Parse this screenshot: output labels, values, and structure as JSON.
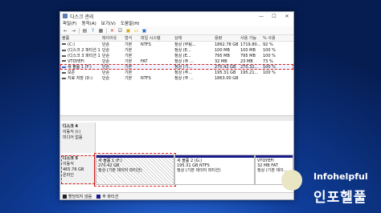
{
  "window": {
    "title": "디스크 관리"
  },
  "window_buttons": {
    "minimize": "—",
    "maximize": "☐",
    "close": "✕"
  },
  "menu": [
    "파일(F)",
    "동작(A)",
    "보기(V)",
    "도움말(H)"
  ],
  "toolbar": {
    "back": "←",
    "forward": "→",
    "properties": "▤",
    "help": "?",
    "grid": "▦",
    "delete": "✕",
    "check": "☑",
    "save": "▣",
    "folder": "▭",
    "magnify": "▣"
  },
  "columns": {
    "volume": "볼륨",
    "layout": "레이아웃",
    "type": "형식",
    "fs": "파일 시스템",
    "status": "상태",
    "capacity": "용량",
    "free": "사용 가능",
    "pct": "% 사용"
  },
  "volumes": [
    {
      "volume": "(C:)",
      "layout": "단순",
      "type": "기본",
      "fs": "NTFS",
      "status": "정상 (부팅...",
      "capacity": "1862.78 GB",
      "free": "1719.80...",
      "pct": "92 %",
      "selected": false
    },
    {
      "volume": "(디스크 2 파티션 1)",
      "layout": "단순",
      "type": "기본",
      "fs": "",
      "status": "정상 (E...",
      "capacity": "100 MB",
      "free": "100 MB",
      "pct": "100 %",
      "selected": false
    },
    {
      "volume": "(디스크 3 파티션 1)",
      "layout": "단순",
      "type": "기본",
      "fs": "",
      "status": "정상 (E...",
      "capacity": "795 MB",
      "free": "795 MB",
      "pct": "100 %",
      "selected": false
    },
    {
      "volume": "VTOYEFI",
      "layout": "단순",
      "type": "기본",
      "fs": "FAT",
      "status": "정상 (주 ...",
      "capacity": "32 MB",
      "free": "23 MB",
      "pct": "73 %",
      "selected": false
    },
    {
      "volume": "새 볼륨 1 (F:)",
      "layout": "단순",
      "type": "기본",
      "fs": "",
      "status": "정상 (기...",
      "capacity": "270.42 GB",
      "free": "270.32...",
      "pct": "100 %",
      "selected": true
    },
    {
      "volume": "보존",
      "layout": "단순",
      "type": "기본",
      "fs": "",
      "status": "정상 (주...",
      "capacity": "195.31 GB",
      "free": "195.21...",
      "pct": "100 %",
      "selected": false
    },
    {
      "volume": "지료 저장 (D:)",
      "layout": "단순",
      "type": "기본",
      "fs": "NTFS",
      "status": "정상 (주 ...",
      "capacity": "1863.00 GB",
      "free": "",
      "pct": "",
      "selected": false
    }
  ],
  "disks": [
    {
      "name": "디스크 4",
      "type": "이동식 (I:)",
      "size": "",
      "state": "미디어 없음",
      "selected": false,
      "partitions": []
    },
    {
      "name": "디스크 5",
      "type": "이동식",
      "size": "465.76 GB",
      "state": "온라인",
      "selected": true,
      "partitions": [
        {
          "title": "새 볼륨 1 (F:)",
          "size": "270.42 GB",
          "status": "정상 (기본 데이터 파티션)",
          "selected": true
        },
        {
          "title": "새 볼륨 2 (G:)",
          "size": "195.31 GB NTFS",
          "status": "정상 (기본 데이터 파티션)",
          "selected": false
        },
        {
          "title": "VTOYEFI",
          "size": "32 MB FAT",
          "status": "정상 (기본 데이...",
          "selected": false
        }
      ]
    }
  ],
  "legend": {
    "unallocated": "할당되지 않음",
    "primary": "주 파티션"
  },
  "watermark": {
    "en": "Infohelpful",
    "ko": "인포헬풀"
  }
}
